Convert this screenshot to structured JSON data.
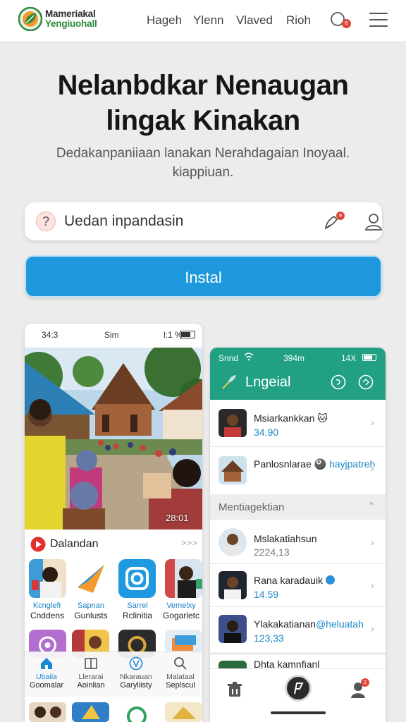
{
  "header": {
    "brand_top": "Mameriakal",
    "brand_bottom": "Yengiuohall",
    "nav": [
      "Hageh",
      "Ylenn",
      "Vlaved",
      "Rioh"
    ],
    "chat_badge": "6"
  },
  "hero": {
    "title": "Nelanbdkar Nenaugan lingak Kinakan",
    "subtitle": "Dedakanpaniiaan lanakan Nerahdagaian Inoyaal. kiappiuan."
  },
  "search": {
    "text": "Uedan inpandasin",
    "pen_badge": "9"
  },
  "install_label": "Instal",
  "left_phone": {
    "status": {
      "time": "34:3",
      "carrier": "Sim",
      "right": "l:1 %"
    },
    "photo_caption": "28:01",
    "video_title": "Dalandan",
    "more": ">>>",
    "apps": [
      {
        "line1": "Kcnglefr",
        "line2": "Cnddens",
        "icon": "person-photo"
      },
      {
        "line1": "Sapnan",
        "line2": "Gunlusts",
        "icon": "paper-plane-icon"
      },
      {
        "line1": "Sarrel",
        "line2": "Rclinitia",
        "icon": "camera-icon"
      },
      {
        "line1": "Vemelxy",
        "line2": "Gogarletc",
        "icon": "person-photo"
      }
    ],
    "bottom_nav": [
      {
        "line1": "Ubaila",
        "line2": "Goomalar",
        "icon": "home-icon",
        "active": true
      },
      {
        "line1": "Llerarai",
        "line2": "Aoinlian",
        "icon": "book-icon",
        "active": false
      },
      {
        "line1": "Nkarauan",
        "line2": "Garyliisty",
        "icon": "v-circle-icon",
        "active": false
      },
      {
        "line1": "Malataal",
        "line2": "Seplscul",
        "icon": "search-icon",
        "active": false
      }
    ]
  },
  "right_phone": {
    "status": {
      "left": "Snnd",
      "center": "394m",
      "right": "14X"
    },
    "title": "Lngeial",
    "items_top": [
      {
        "name": "Msiarkankkan",
        "meta": "34.90",
        "emoji": "🐱"
      },
      {
        "name": "Panlosnlarae",
        "meta": "hayjpatreh",
        "emoji": "🎱"
      }
    ],
    "section_title": "Mentiagektian",
    "items_bottom": [
      {
        "name": "Mslakatiahsun",
        "meta": "2224,13"
      },
      {
        "name": "Rana karadauik",
        "meta": "14.59"
      },
      {
        "name": "Ylakakatianan",
        "handle": "@heluatah",
        "meta": "123,33"
      },
      {
        "name": "Dhta kamnfianl",
        "meta": ""
      }
    ],
    "bottom_badge": "2"
  },
  "colors": {
    "accent_blue": "#1d98dc",
    "brand_green": "#2c8a3a",
    "teal_header": "#21a084",
    "link_blue": "#1a88c9",
    "badge_red": "#e0453a"
  }
}
